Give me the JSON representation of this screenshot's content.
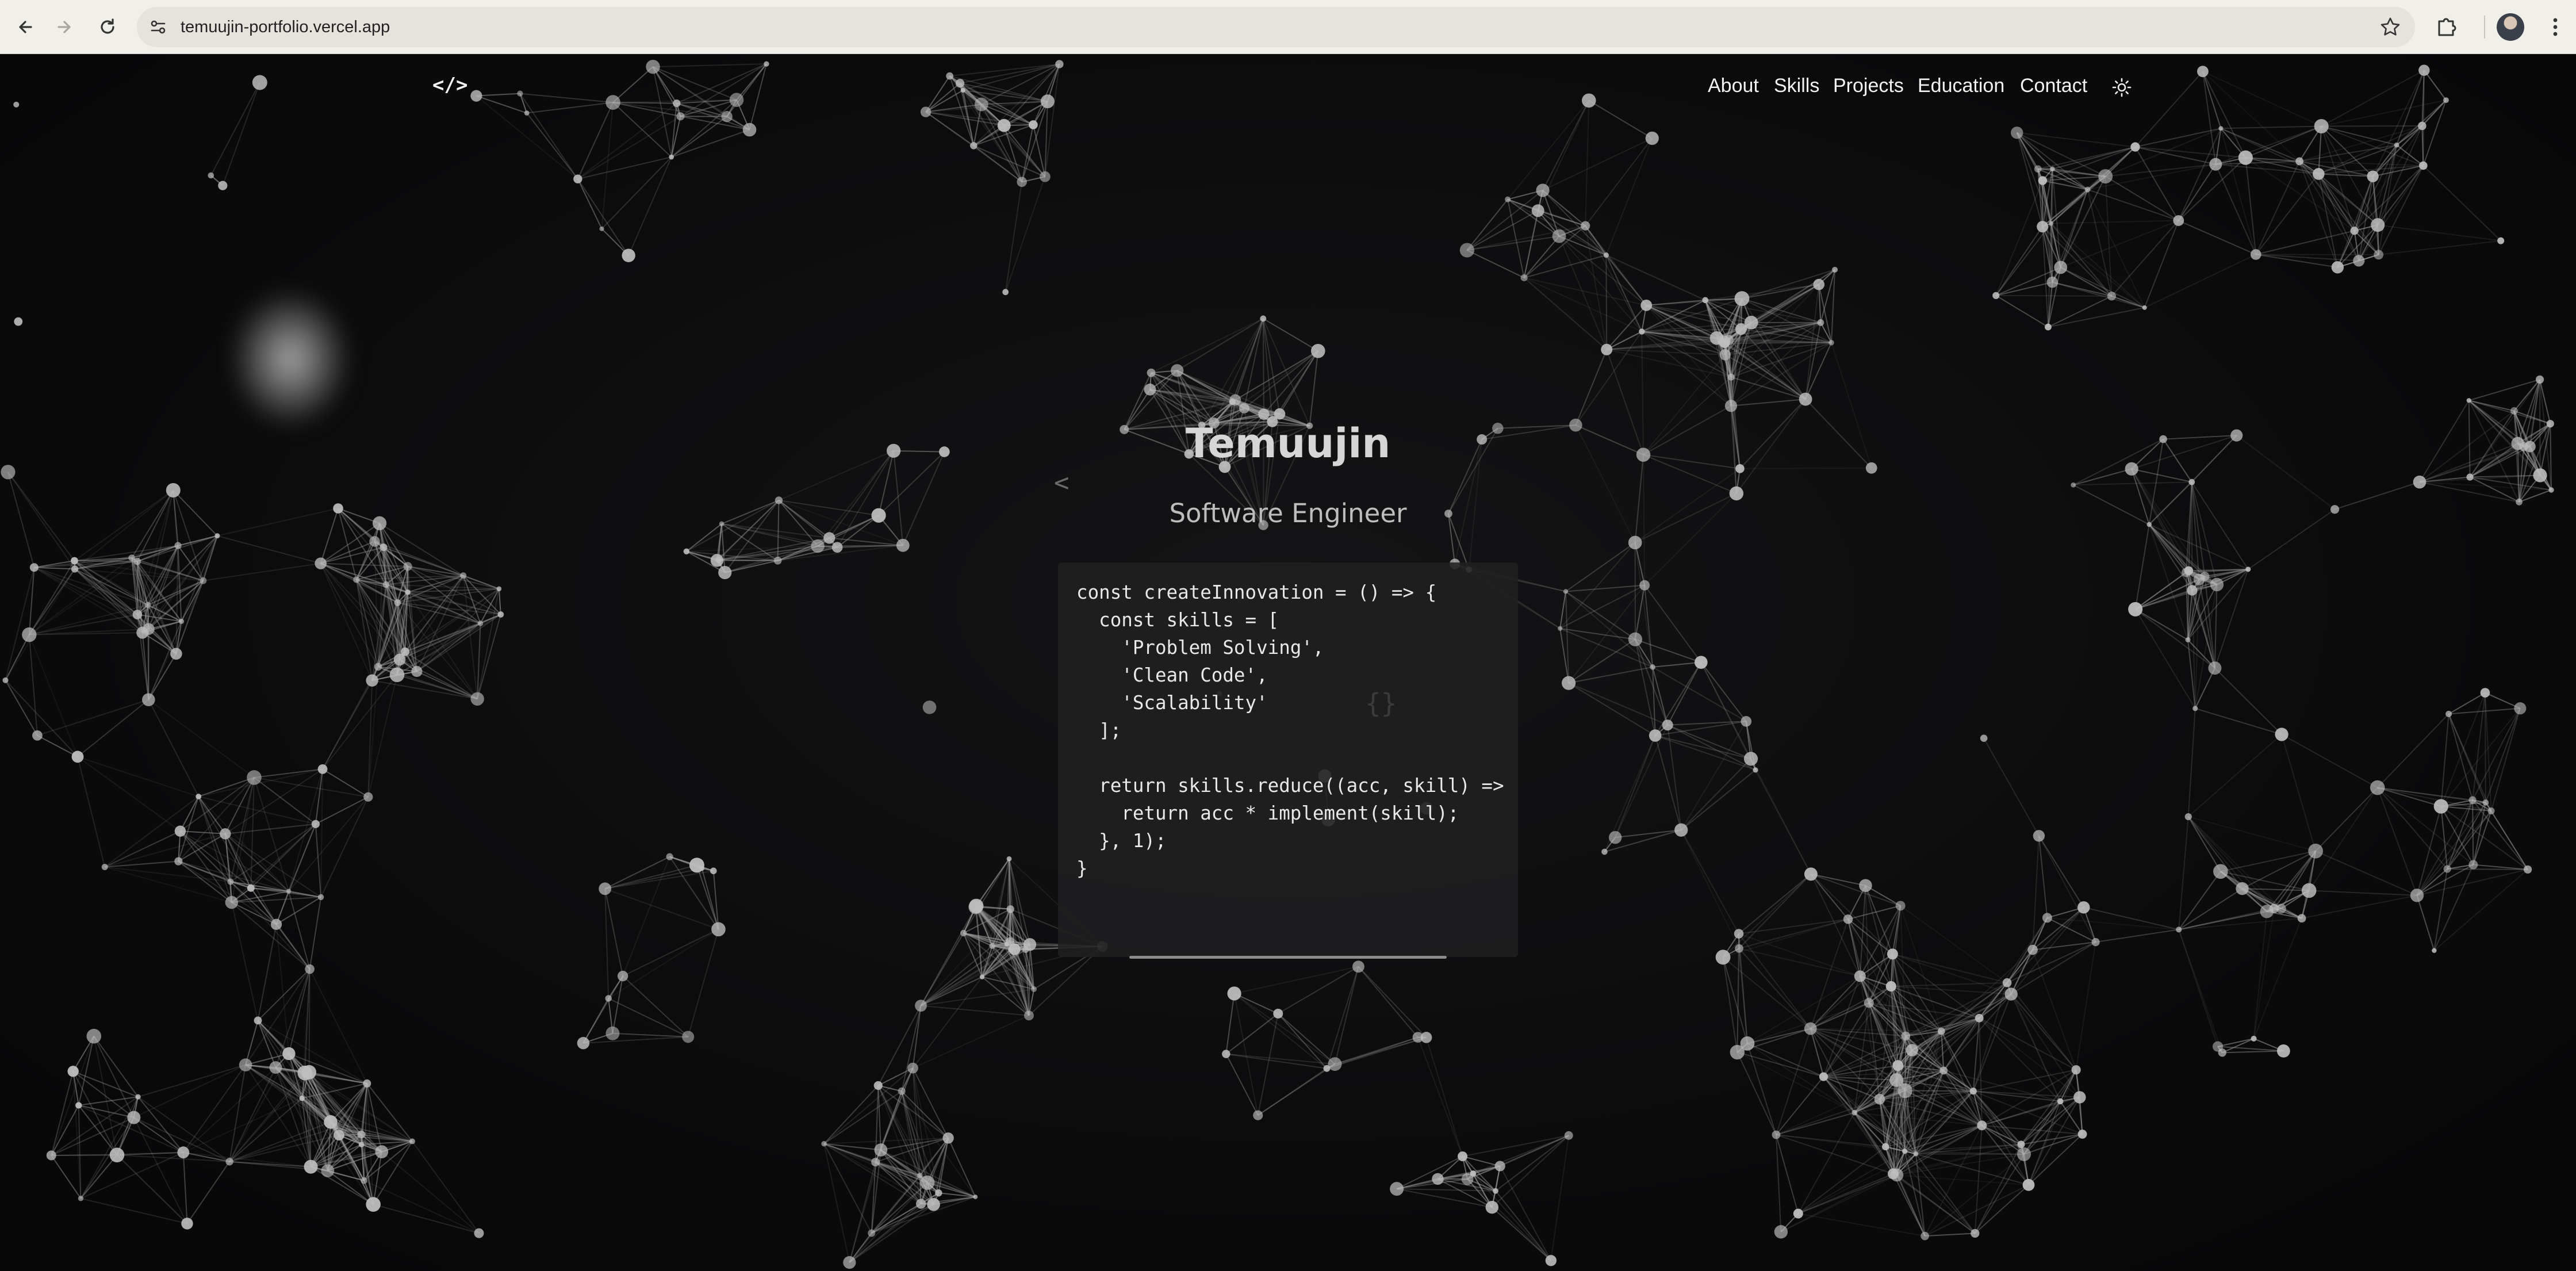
{
  "browser": {
    "url": "temuujin-portfolio.vercel.app",
    "icons": [
      "back-arrow-icon",
      "forward-arrow-icon",
      "reload-icon",
      "site-settings-icon",
      "bookmark-star-icon",
      "extensions-puzzle-icon",
      "profile-avatar",
      "menu-dots-icon"
    ]
  },
  "site": {
    "logo": "</>",
    "nav": [
      {
        "label": "About"
      },
      {
        "label": "Skills"
      },
      {
        "label": "Projects"
      },
      {
        "label": "Education"
      },
      {
        "label": "Contact"
      }
    ],
    "theme_toggle_icon": "sun-icon"
  },
  "hero": {
    "name": "Temuujin",
    "role": "Software Engineer",
    "deco_left": "<",
    "deco_right": "{}",
    "code": "const createInnovation = () => {\n  const skills = [\n    'Problem Solving',\n    'Clean Code',\n    'Scalability'\n  ];\n\n  return skills.reduce((acc, skill) =>\n    return acc * implement(skill);\n  }, 1);\n}"
  },
  "colors": {
    "background": "#0b0b0c",
    "network_line": "#9a9a9a",
    "network_node": "#bfbfbf",
    "text": "#f2f2f2"
  }
}
